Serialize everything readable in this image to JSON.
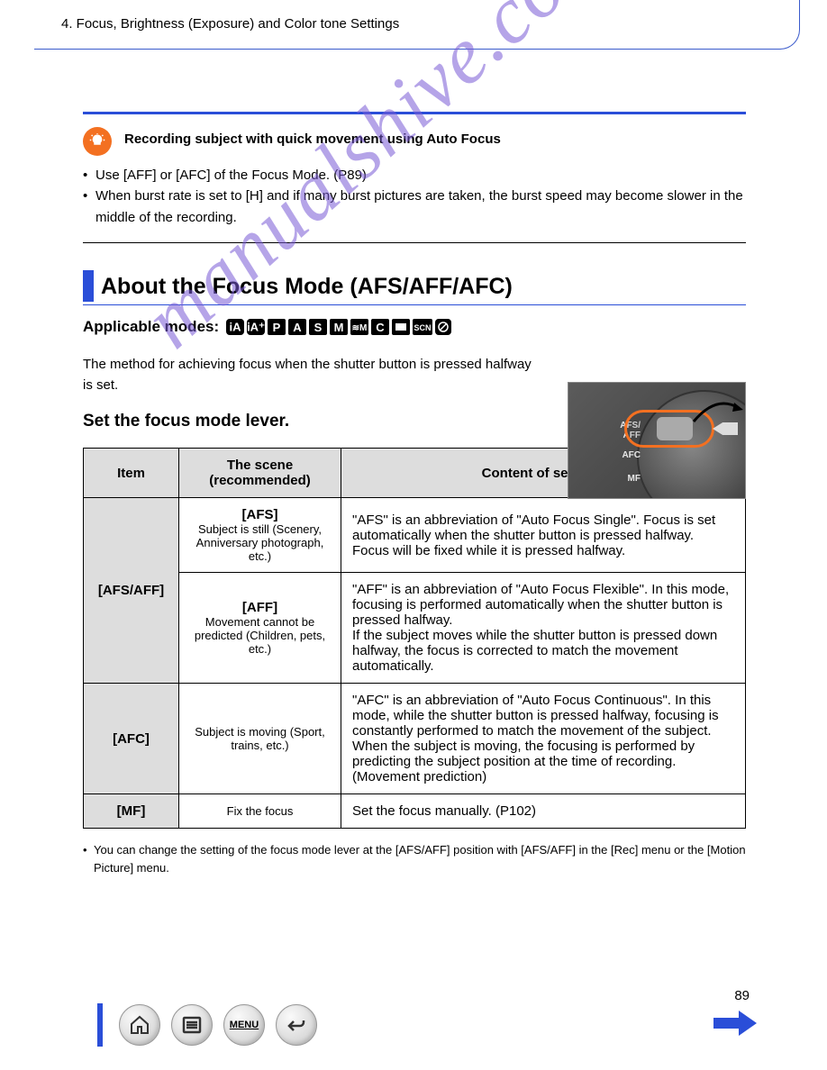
{
  "breadcrumb": "4. Focus, Brightness (Exposure) and Color tone Settings",
  "tip": {
    "heading_text": "Recording subject with quick movement using Auto Focus",
    "bullets": [
      "Use [AFF] or [AFC] of the Focus Mode. (P89)",
      "When burst rate is set to [H] and if many burst pictures are taken, the burst speed may become slower in the middle of the recording."
    ]
  },
  "section": {
    "title": "About the Focus Mode (AFS/AFF/AFC)",
    "modes_label": "Applicable modes:",
    "intro": "The method for achieving focus when the shutter button is pressed halfway is set.",
    "step": "Set the focus mode lever.",
    "camera_labels": {
      "l1": "AFS/\nAFF",
      "l2": "AFC",
      "l3": "MF"
    }
  },
  "table": {
    "headers": {
      "item": "Item",
      "scene": "The scene (recommended)",
      "content": "Content of settings"
    },
    "rows": [
      {
        "item": "[AFS/AFF]",
        "scene1": "[AFS]",
        "scene1_sub": "Subject is still (Scenery, Anniversary photograph, etc.)",
        "content1": "\"AFS\" is an abbreviation of \"Auto Focus Single\". Focus is set automatically when the shutter button is pressed halfway. Focus will be fixed while it is pressed halfway.",
        "scene2": "[AFF]",
        "scene2_sub": "Movement cannot be predicted (Children, pets, etc.)",
        "content2": "\"AFF\" is an abbreviation of \"Auto Focus Flexible\". In this mode, focusing is performed automatically when the shutter button is pressed halfway.",
        "content2b": "If the subject moves while the shutter button is pressed down halfway, the focus is corrected to match the movement automatically."
      },
      {
        "item": "[AFC]",
        "scene": "Subject is moving (Sport, trains, etc.)",
        "content": "\"AFC\" is an abbreviation of \"Auto Focus Continuous\". In this mode, while the shutter button is pressed halfway, focusing is constantly performed to match the movement of the subject. When the subject is moving, the focusing is performed by predicting the subject position at the time of recording. (Movement prediction)"
      },
      {
        "item": "[MF]",
        "scene": "Fix the focus",
        "content": "Set the focus manually. (P102)"
      }
    ],
    "notes": [
      "You can change the setting of the focus mode lever at the [AFS/AFF] position with [AFS/AFF] in the [Rec] menu or the [Motion Picture] menu."
    ]
  },
  "watermark": "manualshive.com",
  "page_number": "89",
  "nav": {
    "menu_label": "MENU"
  }
}
